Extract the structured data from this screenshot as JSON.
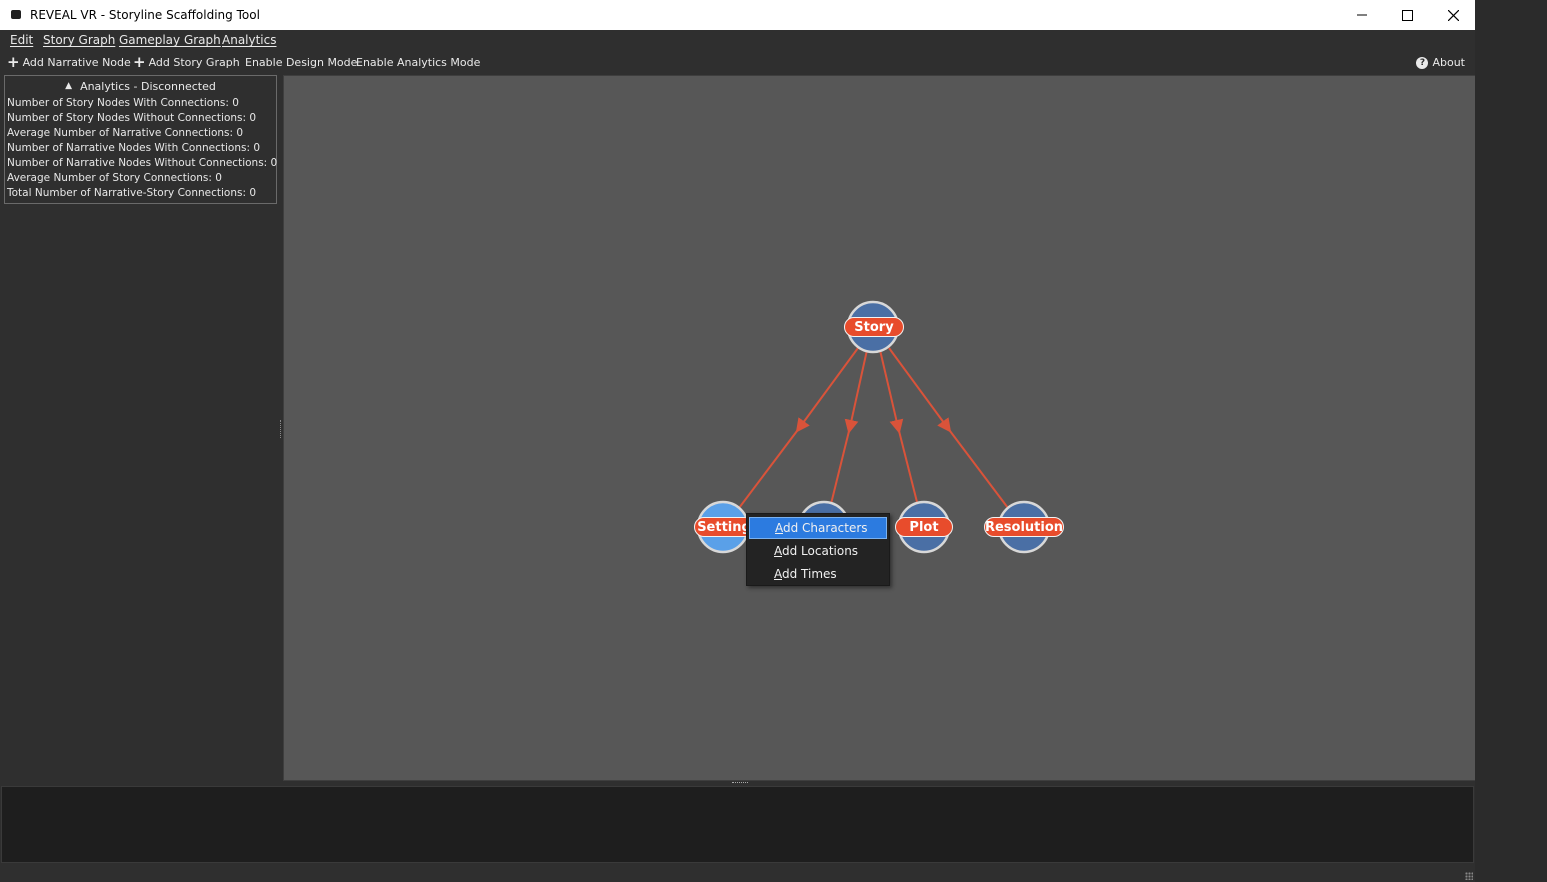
{
  "window": {
    "title": "REVEAL VR - Storyline Scaffolding Tool",
    "minimize_icon": "minimize-icon",
    "maximize_icon": "maximize-icon",
    "close_icon": "close-icon"
  },
  "menubar": {
    "items": [
      "Edit",
      "Story Graph",
      "Gameplay Graph",
      "Analytics"
    ]
  },
  "toolbar": {
    "add_narrative_node": "Add Narrative Node",
    "add_story_graph": "Add Story Graph",
    "enable_design_mode": "Enable Design Mode",
    "enable_analytics_mode": "Enable Analytics Mode",
    "about": "About"
  },
  "analytics": {
    "header": "Analytics - Disconnected",
    "collapse_icon": "collapse-triangle-icon",
    "stats": [
      "Number of Story Nodes With Connections: 0",
      "Number of Story Nodes Without Connections: 0",
      "Average Number of Narrative Connections: 0",
      "Number of Narrative Nodes With Connections: 0",
      "Number of Narrative Nodes Without Connections: 0",
      "Average Number of Story Connections: 0",
      "Total Number of Narrative-Story Connections: 0"
    ]
  },
  "graph": {
    "nodes": {
      "story": "Story",
      "setting": "Setting",
      "plot": "Plot",
      "resolution": "Resolution"
    },
    "colors": {
      "node_fill": "#4a6fa5",
      "node_selected_fill": "#5aa0e8",
      "node_border": "#d8d8d8",
      "label_fill": "#e84c2c",
      "edge": "#d9533a",
      "canvas": "#575757"
    }
  },
  "context_menu": {
    "items": [
      {
        "first": "A",
        "rest": "dd Characters",
        "active": true
      },
      {
        "first": "A",
        "rest": "dd Locations",
        "active": false
      },
      {
        "first": "A",
        "rest": "dd Times",
        "active": false
      }
    ]
  }
}
